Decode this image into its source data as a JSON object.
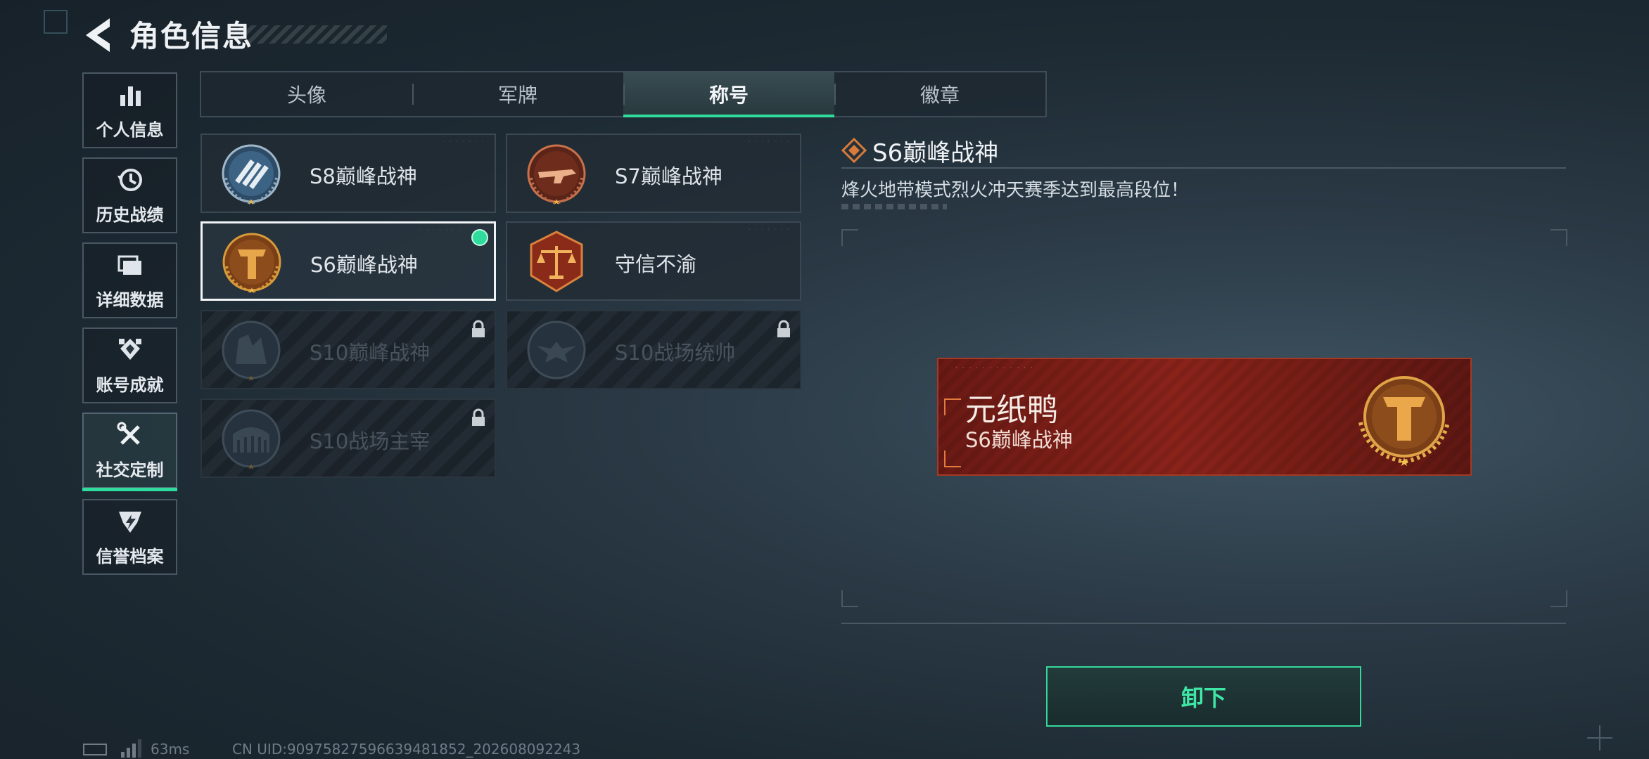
{
  "header": {
    "title": "角色信息"
  },
  "sidebar": {
    "items": [
      {
        "label": "个人信息",
        "icon": "bar-chart-icon"
      },
      {
        "label": "历史战绩",
        "icon": "history-icon"
      },
      {
        "label": "详细数据",
        "icon": "folder-icon"
      },
      {
        "label": "账号成就",
        "icon": "achievement-icon"
      },
      {
        "label": "社交定制",
        "icon": "tools-icon",
        "active": true
      },
      {
        "label": "信誉档案",
        "icon": "credit-shield-icon"
      }
    ]
  },
  "tabs": [
    {
      "label": "头像"
    },
    {
      "label": "军牌"
    },
    {
      "label": "称号",
      "active": true
    },
    {
      "label": "徽章"
    }
  ],
  "titles": [
    {
      "label": "S8巅峰战神",
      "emblem": "s8-emblem",
      "locked": false
    },
    {
      "label": "S7巅峰战神",
      "emblem": "s7-emblem",
      "locked": false
    },
    {
      "label": "S6巅峰战神",
      "emblem": "s6-emblem",
      "locked": false,
      "selected": true,
      "equipped": true
    },
    {
      "label": "守信不渝",
      "emblem": "scales-emblem",
      "locked": false
    },
    {
      "label": "S10巅峰战神",
      "emblem": "s10-emblem",
      "locked": true
    },
    {
      "label": "S10战场统帅",
      "emblem": "s10-commander-emblem",
      "locked": true
    },
    {
      "label": "S10战场主宰",
      "emblem": "s10-dominator-emblem",
      "locked": true
    }
  ],
  "detail": {
    "title": "S6巅峰战神",
    "description": "烽火地带模式烈火冲天赛季达到最高段位！"
  },
  "nameplate": {
    "player_name": "元纸鸭",
    "title": "S6巅峰战神"
  },
  "actions": {
    "unequip_label": "卸下"
  },
  "status_bar": {
    "ping": "63ms",
    "uid": "CN UID:90975827596639481852_202608092243"
  },
  "colors": {
    "accent": "#2fdc9e",
    "nameplate_red": "#8a231a",
    "gold": "#d79a3a"
  }
}
